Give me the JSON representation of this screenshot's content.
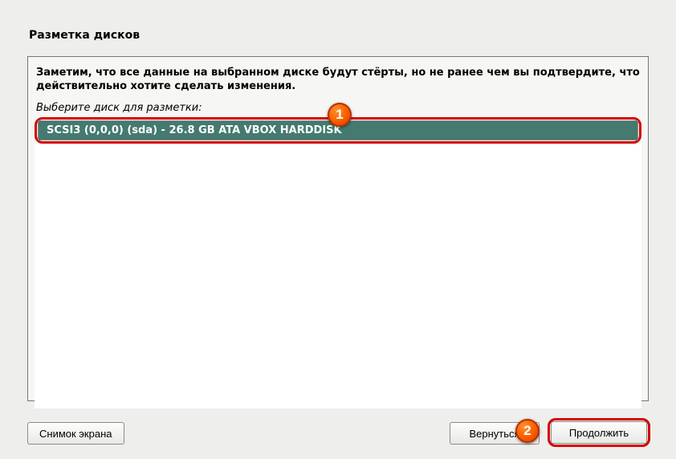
{
  "title": "Разметка дисков",
  "warning_text": "Заметим, что все данные на выбранном диске будут стёрты, но не ранее чем вы подтвердите, что действительно хотите сделать изменения.",
  "prompt_text": "Выберите диск для разметки:",
  "disk_item": "SCSI3 (0,0,0) (sda) - 26.8 GB ATA VBOX HARDDISK",
  "badges": {
    "one": "1",
    "two": "2"
  },
  "buttons": {
    "screenshot": "Снимок экрана",
    "back": "Вернуться",
    "continue": "Продолжить"
  }
}
